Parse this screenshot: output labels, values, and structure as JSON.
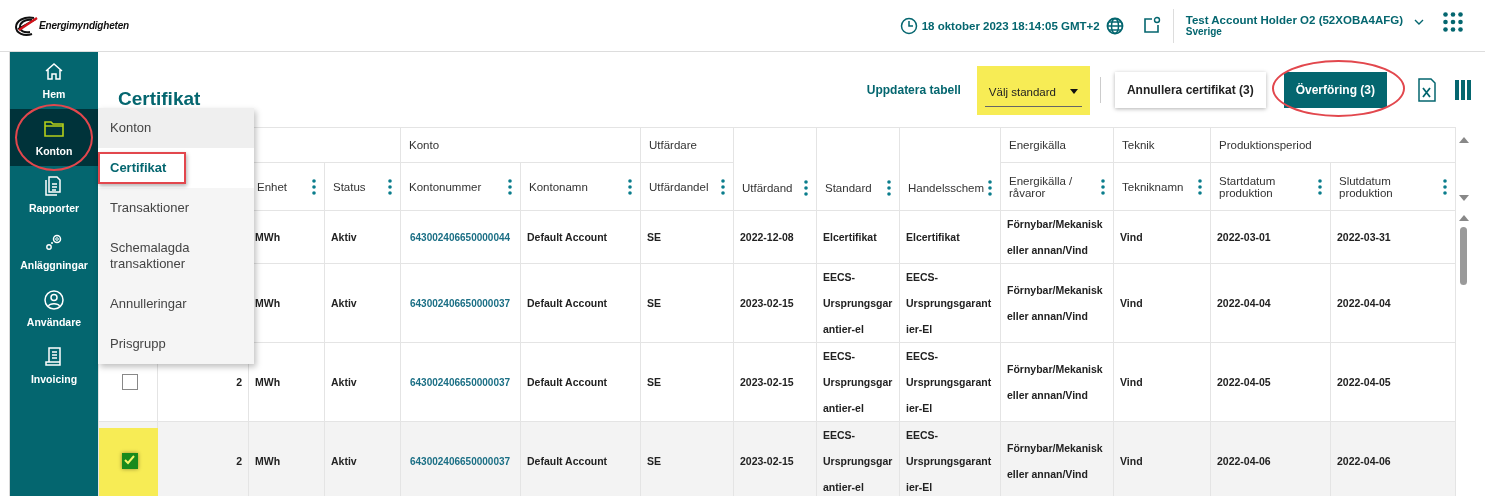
{
  "header": {
    "logo_text": "Energimyndigheten",
    "datetime": "18 oktober 2023 18:14:05 GMT+2",
    "account_name": "Test Account Holder O2 (52XOBA4AFG)",
    "account_country": "Sverige"
  },
  "sidebar": {
    "items": [
      {
        "label": "Hem",
        "selected": false
      },
      {
        "label": "Konton",
        "selected": true
      },
      {
        "label": "Rapporter",
        "selected": false
      },
      {
        "label": "Anläggningar",
        "selected": false
      },
      {
        "label": "Användare",
        "selected": false
      },
      {
        "label": "Invoicing",
        "selected": false
      }
    ]
  },
  "submenu": {
    "items": [
      {
        "label": "Konton",
        "kind": "heading",
        "selected": false
      },
      {
        "label": "Certifikat",
        "kind": "link",
        "selected": true
      },
      {
        "label": "Transaktioner",
        "kind": "link",
        "selected": false
      },
      {
        "label": "Schemalagda transaktioner",
        "kind": "link",
        "selected": false
      },
      {
        "label": "Annulleringar",
        "kind": "link",
        "selected": false
      },
      {
        "label": "Prisgrupp",
        "kind": "link",
        "selected": false
      }
    ]
  },
  "page": {
    "title": "Certifikat"
  },
  "toolbar": {
    "refresh_link": "Uppdatera tabell",
    "standard_select": {
      "value": "Välj standard"
    },
    "buttons": [
      {
        "label": "Annullera certifikat (3)",
        "kind": "secondary"
      },
      {
        "label": "Överföring (3)",
        "kind": "primary"
      }
    ]
  },
  "table": {
    "column_groups": [
      {
        "columns": [
          {
            "kind": "checkbox"
          },
          {
            "kind": "quantity"
          },
          {
            "label": "Enhet",
            "kind": "text"
          },
          {
            "label": "Status",
            "kind": "text"
          }
        ]
      },
      {
        "label": "Konto",
        "columns": [
          {
            "label": "Kontonummer",
            "kind": "link"
          },
          {
            "label": "Kontonamn",
            "kind": "text"
          }
        ]
      },
      {
        "label": "Utfärdare",
        "columns": [
          {
            "label": "Utfärdandel",
            "kind": "text"
          }
        ]
      },
      {
        "columns": [
          {
            "label": "Utfärdand",
            "kind": "text"
          }
        ]
      },
      {
        "columns": [
          {
            "label": "Standard",
            "kind": "text"
          }
        ]
      },
      {
        "columns": [
          {
            "label": "Handelsschem",
            "kind": "text"
          }
        ]
      },
      {
        "label": "Energikälla",
        "columns": [
          {
            "label": "Energikälla / råvaror",
            "kind": "text"
          }
        ]
      },
      {
        "label": "Teknik",
        "columns": [
          {
            "label": "Tekniknamn",
            "kind": "text"
          }
        ]
      },
      {
        "label": "Produktionsperiod",
        "columns": [
          {
            "label": "Startdatum produktion",
            "kind": "text"
          },
          {
            "label": "Slutdatum produktion",
            "kind": "text"
          }
        ]
      }
    ],
    "rows": [
      {
        "selected": false,
        "cells": [
          "MWh",
          "Aktiv",
          "643002406650000044",
          "Default Account",
          "SE",
          "2022-12-08",
          "Elcertifikat",
          "Elcertifikat",
          "Förnybar/Mekanisk eller annan/Vind",
          "Vind",
          "2022-03-01",
          "2022-03-31"
        ]
      },
      {
        "selected": false,
        "cells": [
          "MWh",
          "Aktiv",
          "643002406650000037",
          "Default Account",
          "SE",
          "2023-02-15",
          "EECS-Ursprungsgarantier-el",
          "EECS-Ursprungsgarantier-El",
          "Förnybar/Mekanisk eller annan/Vind",
          "Vind",
          "2022-04-04",
          "2022-04-04"
        ]
      },
      {
        "selected": false,
        "checked": false,
        "quantity": "2",
        "cells": [
          "MWh",
          "Aktiv",
          "643002406650000037",
          "Default Account",
          "SE",
          "2023-02-15",
          "EECS-Ursprungsgarantier-el",
          "EECS-Ursprungsgarantier-El",
          "Förnybar/Mekanisk eller annan/Vind",
          "Vind",
          "2022-04-05",
          "2022-04-05"
        ]
      },
      {
        "selected": true,
        "checked": true,
        "quantity": "2",
        "cells": [
          "MWh",
          "Aktiv",
          "643002406650000037",
          "Default Account",
          "SE",
          "2023-02-15",
          "EECS-Ursprungsgarantier-el",
          "EECS-Ursprungsgarantier-El",
          "Förnybar/Mekanisk eller annan/Vind",
          "Vind",
          "2022-04-06",
          "2022-04-06"
        ]
      }
    ]
  }
}
